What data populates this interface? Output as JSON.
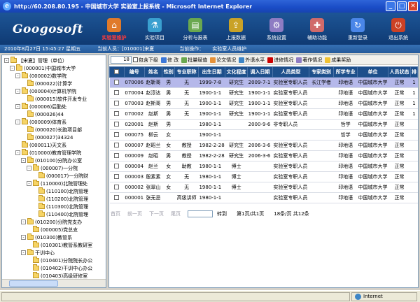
{
  "window": {
    "title": "http://60.208.80.195 - 中国城市大学 实验室上报系统 - Microsoft Internet Explorer",
    "minimize": "_",
    "maximize": "□",
    "close": "✕"
  },
  "header": {
    "logo": "Googosoft",
    "nav": [
      {
        "label": "实验室维护",
        "icon": "house-icon",
        "color": "#e07a2a",
        "glyph": "⌂",
        "active": true
      },
      {
        "label": "实验项目",
        "icon": "flask-icon",
        "color": "#3aa0d0",
        "glyph": "⚗",
        "active": false
      },
      {
        "label": "分析与报表",
        "icon": "report-icon",
        "color": "#6aa84f",
        "glyph": "▤",
        "active": false
      },
      {
        "label": "上报数据",
        "icon": "upload-icon",
        "color": "#c9a227",
        "glyph": "⇪",
        "active": false
      },
      {
        "label": "系统设置",
        "icon": "gear-icon",
        "color": "#8e7cc3",
        "glyph": "⚙",
        "active": false
      },
      {
        "label": "辅助功能",
        "icon": "tools-icon",
        "color": "#d06a6a",
        "glyph": "✚",
        "active": false
      },
      {
        "label": "重新登录",
        "icon": "login-icon",
        "color": "#4a86e8",
        "glyph": "↻",
        "active": false
      },
      {
        "label": "退出系统",
        "icon": "exit-icon",
        "color": "#cc4125",
        "glyph": "⏻",
        "active": false
      }
    ]
  },
  "infobar": {
    "datetime": "2010年8月27日 15:45:27 星期五",
    "user_label": "当前人员：",
    "user_value": "[010001]宋夏",
    "op_label": "当前操作：",
    "op_value": "实验室人员维护"
  },
  "tree": {
    "nodes": [
      {
        "text": "【宋夏】管理（单位）",
        "depth": 0,
        "pm": "-"
      },
      {
        "text": "(000001)中国城市大学",
        "depth": 1,
        "pm": "-"
      },
      {
        "text": "(000002)数学院",
        "depth": 2,
        "pm": "-"
      },
      {
        "text": "(000022)计算学",
        "depth": 3,
        "pm": ""
      },
      {
        "text": "(000004)计算机学院",
        "depth": 2,
        "pm": "-"
      },
      {
        "text": "(000015)软件开发专业",
        "depth": 3,
        "pm": ""
      },
      {
        "text": "(000006)后勤处",
        "depth": 2,
        "pm": "-"
      },
      {
        "text": "(000026)44",
        "depth": 3,
        "pm": ""
      },
      {
        "text": "(000009)体育系",
        "depth": 2,
        "pm": "-"
      },
      {
        "text": "(000020)长跑项目部",
        "depth": 3,
        "pm": ""
      },
      {
        "text": "(000027)34324",
        "depth": 3,
        "pm": ""
      },
      {
        "text": "(000011)天文系",
        "depth": 2,
        "pm": ""
      },
      {
        "text": "(010000)教育管理学院",
        "depth": 2,
        "pm": "-"
      },
      {
        "text": "(010100)分院办公室",
        "depth": 3,
        "pm": "-"
      },
      {
        "text": "(000007)一分院",
        "depth": 4,
        "pm": "-"
      },
      {
        "text": "(000017)一分院财",
        "depth": 5,
        "pm": ""
      },
      {
        "text": "(110000)北院管理处",
        "depth": 4,
        "pm": "-"
      },
      {
        "text": "(110100)北院管理",
        "depth": 5,
        "pm": ""
      },
      {
        "text": "(110200)北院管理",
        "depth": 5,
        "pm": ""
      },
      {
        "text": "(110300)北院管理",
        "depth": 5,
        "pm": ""
      },
      {
        "text": "(110400)北院管理",
        "depth": 5,
        "pm": ""
      },
      {
        "text": "(010200)分院党支办",
        "depth": 3,
        "pm": "-"
      },
      {
        "text": "(000005)党总支",
        "depth": 4,
        "pm": ""
      },
      {
        "text": "(010300)教管系",
        "depth": 3,
        "pm": "-"
      },
      {
        "text": "(010301)教管系教研室",
        "depth": 4,
        "pm": ""
      },
      {
        "text": "干训中心",
        "depth": 3,
        "pm": "-"
      },
      {
        "text": "(010401)分院院长办公",
        "depth": 4,
        "pm": ""
      },
      {
        "text": "(010402)干训中心办公",
        "depth": 4,
        "pm": ""
      },
      {
        "text": "(010403)高级研修室",
        "depth": 4,
        "pm": ""
      }
    ]
  },
  "toolbar": {
    "count_value": "18",
    "include_sub": "包含下级",
    "items": [
      {
        "label": "修 改",
        "icon": "edit-icon",
        "color": "#3c78d8"
      },
      {
        "label": "批量赋值",
        "icon": "batch-icon",
        "color": "#6aa84f"
      },
      {
        "label": "论文情况",
        "icon": "paper-icon",
        "color": "#e69138"
      },
      {
        "label": "外语水平",
        "icon": "language-icon",
        "color": "#3d85c6"
      },
      {
        "label": "进修情况",
        "icon": "study-icon",
        "color": "#cc0000"
      },
      {
        "label": "著作情况",
        "icon": "book-icon",
        "color": "#8e7cc3"
      },
      {
        "label": "成果奖励",
        "icon": "award-icon",
        "color": "#f1c232"
      }
    ]
  },
  "grid": {
    "columns": [
      "编号",
      "姓名",
      "性别",
      "专业职称",
      "出生日期",
      "文化程度",
      "调入日期",
      "人员类型",
      "专家类别",
      "所学专业",
      "单位",
      "人员状态",
      "排"
    ],
    "rows": [
      [
        "070006",
        "赵靳哥",
        "男",
        "无",
        "1999-7-8",
        "研究生",
        "2009-7-1",
        "实验室专职人员",
        "长江学者",
        "印地语",
        "中国城市大学",
        "正常",
        "1"
      ],
      [
        "070004",
        "赵淳达",
        "男",
        "无",
        "1900-1-1",
        "研究生",
        "1900-1-1",
        "实验室专职人员",
        "",
        "印地语",
        "中国城市大学",
        "正常",
        "1"
      ],
      [
        "070003",
        "赵斯哥",
        "男",
        "无",
        "1900-1-1",
        "研究生",
        "1900-1-1",
        "实验室专职人员",
        "",
        "印地语",
        "中国城市大学",
        "正常",
        "1"
      ],
      [
        "070002",
        "赵斯",
        "男",
        "无",
        "1900-1-1",
        "研究生",
        "1900-1-1",
        "实验室专职人员",
        "",
        "印地语",
        "中国城市大学",
        "正常",
        "1"
      ],
      [
        "020001",
        "赵斯",
        "男",
        "",
        "1980-1-1",
        "",
        "2000-9-6",
        "非专职人员",
        "",
        "哲学",
        "中国城市大学",
        "正常",
        ""
      ],
      [
        "000075",
        "柳云",
        "女",
        "",
        "1900-1-1",
        "",
        "",
        "",
        "",
        "哲学",
        "中国城市大学",
        "正常",
        ""
      ],
      [
        "000007",
        "赵昭兰",
        "女",
        "教授",
        "1982-2-28",
        "研究生",
        "2006-3-6",
        "实验室专职人员",
        "",
        "印地语",
        "中国城市大学",
        "正常",
        ""
      ],
      [
        "000009",
        "赵昭",
        "男",
        "教授",
        "1982-2-28",
        "研究生",
        "2006-3-6",
        "实验室专职人员",
        "",
        "印地语",
        "中国城市大学",
        "正常",
        ""
      ],
      [
        "000004",
        "赵兰",
        "女",
        "助教",
        "1980-1-1",
        "博士",
        "",
        "实验室专职人员",
        "",
        "印地语",
        "中国城市大学",
        "正常",
        ""
      ],
      [
        "000003",
        "殷素素",
        "女",
        "无",
        "1980-1-1",
        "博士",
        "",
        "实验室专职人员",
        "",
        "印地语",
        "中国城市大学",
        "正常",
        ""
      ],
      [
        "000002",
        "张翠山",
        "女",
        "无",
        "1980-1-1",
        "博士",
        "",
        "实验室专职人员",
        "",
        "印地语",
        "中国城市大学",
        "正常",
        ""
      ],
      [
        "000001",
        "张无忌",
        "",
        "高级讲师",
        "1980-1-1",
        "",
        "",
        "实验室专职人员",
        "",
        "印地语",
        "中国城市大学",
        "正常",
        ""
      ]
    ]
  },
  "pager": {
    "first": "首页",
    "prev": "前一页",
    "next": "下一页",
    "last": "尾页",
    "goto": "转到",
    "page_info": "第1页/共1页",
    "count_info": "18条/页 共12条"
  },
  "status": {
    "zone": "Internet"
  }
}
